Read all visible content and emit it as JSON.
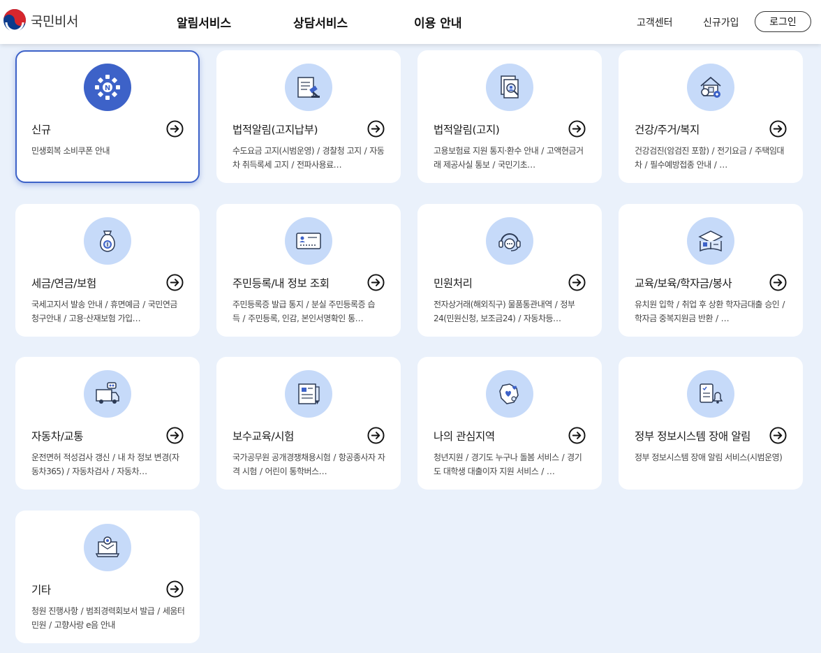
{
  "header": {
    "logo_text": "국민비서",
    "nav": [
      "알림서비스",
      "상담서비스",
      "이용 안내"
    ],
    "util": [
      "고객센터",
      "신규가입"
    ],
    "login_label": "로그인"
  },
  "cards": [
    {
      "title": "신규",
      "icon": "new-badge-icon",
      "items": [
        "민생회복 소비쿠폰 안내"
      ]
    },
    {
      "title": "법적알림(고지납부)",
      "icon": "gavel-document-icon",
      "items": [
        "수도요금 고지(시범운영)",
        "경찰청 고지",
        "자동차 취득록세 고지",
        "전파사용료…"
      ]
    },
    {
      "title": "법적알림(고지)",
      "icon": "legal-notice-icon",
      "items": [
        "고용보험료 지원 통지·환수 안내",
        "고액현금거래 제공사실 통보",
        "국민기초…"
      ]
    },
    {
      "title": "건강/주거/복지",
      "icon": "house-health-icon",
      "items": [
        "건강검진(암검진 포함)",
        "전기요금",
        "주택임대차",
        "필수예방접종 안내",
        "…"
      ]
    },
    {
      "title": "세금/연금/보험",
      "icon": "money-bag-icon",
      "items": [
        "국세고지서 발송 안내",
        "휴면예금",
        "국민연금 청구안내",
        "고용·산재보험 가입…"
      ]
    },
    {
      "title": "주민등록/내 정보 조회",
      "icon": "id-card-icon",
      "items": [
        "주민등록증 발급 통지",
        "분실 주민등록증 습득",
        "주민등록, 인감, 본인서명확인 통…"
      ]
    },
    {
      "title": "민원처리",
      "icon": "headset-icon",
      "items": [
        "전자상거래(해외직구) 물품통관내역",
        "정부24(민원신청, 보조금24)",
        "자동차등…"
      ]
    },
    {
      "title": "교육/보육/학자금/봉사",
      "icon": "graduation-book-icon",
      "items": [
        "유치원 입학",
        "취업 후 상환 학자금대출 승인",
        "학자금 중복지원금 반환",
        "…"
      ]
    },
    {
      "title": "자동차/교통",
      "icon": "truck-icon",
      "items": [
        "운전면허 적성검사 갱신",
        "내 차 정보 변경(자동차365)",
        "자동차검사",
        "자동차…"
      ]
    },
    {
      "title": "보수교육/시험",
      "icon": "exam-paper-icon",
      "items": [
        "국가공무원 공개경쟁채용시험",
        "항공종사자 자격 시험",
        "어린이 통학버스…"
      ]
    },
    {
      "title": "나의 관심지역",
      "icon": "map-heart-icon",
      "items": [
        "청년지원",
        "경기도 누구나 돌봄 서비스",
        "경기도 대학생 대출이자 지원 서비스",
        "…"
      ]
    },
    {
      "title": "정부 정보시스템 장애 알림",
      "icon": "checklist-bell-icon",
      "items": [
        "정부 정보시스템 장애 알림 서비스(시범운영)"
      ]
    },
    {
      "title": "기타",
      "icon": "mail-laptop-icon",
      "items": [
        "청원 진행사항",
        "범죄경력회보서 발급",
        "세움터 민원",
        "고향사랑 e음 안내"
      ]
    }
  ],
  "colors": {
    "accent": "#3d62c8",
    "icon_bg": "#c6daf9",
    "page_bg": "#eaf1fb"
  }
}
